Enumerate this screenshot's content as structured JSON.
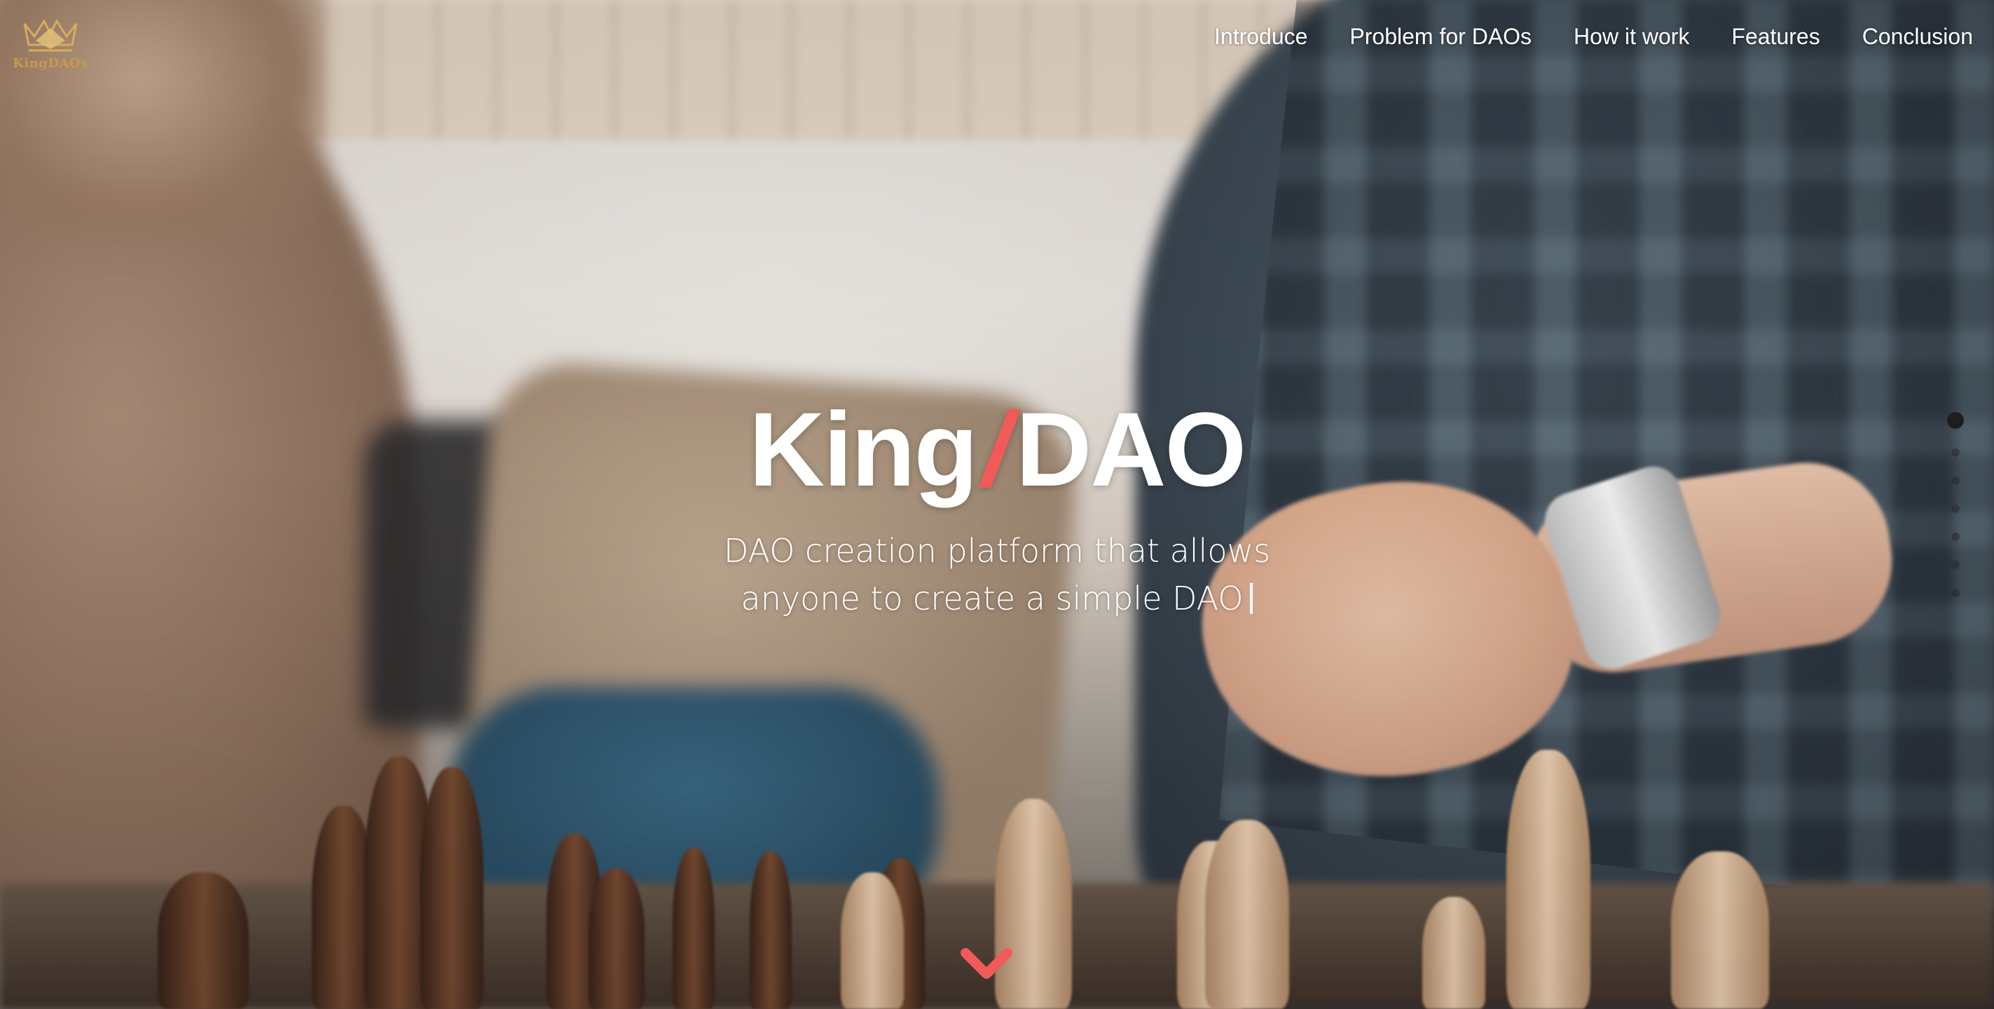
{
  "brand": {
    "logo_text": "KingDAOs",
    "logo_icon": "crown-icon",
    "accent_color": "#c79a4b"
  },
  "nav": {
    "items": [
      {
        "label": "Introduce"
      },
      {
        "label": "Problem for DAOs"
      },
      {
        "label": "How it work"
      },
      {
        "label": "Features"
      },
      {
        "label": "Conclusion"
      }
    ]
  },
  "hero": {
    "title_left": "King",
    "title_sep": "/",
    "title_right": "DAO",
    "subtitle_line1": "DAO creation platform that allows",
    "subtitle_line2": "anyone to create a simple DAO",
    "slash_color": "#f25a5a",
    "scroll_icon": "chevron-down-icon"
  },
  "section_dots": {
    "count": 7,
    "active_index": 0
  }
}
